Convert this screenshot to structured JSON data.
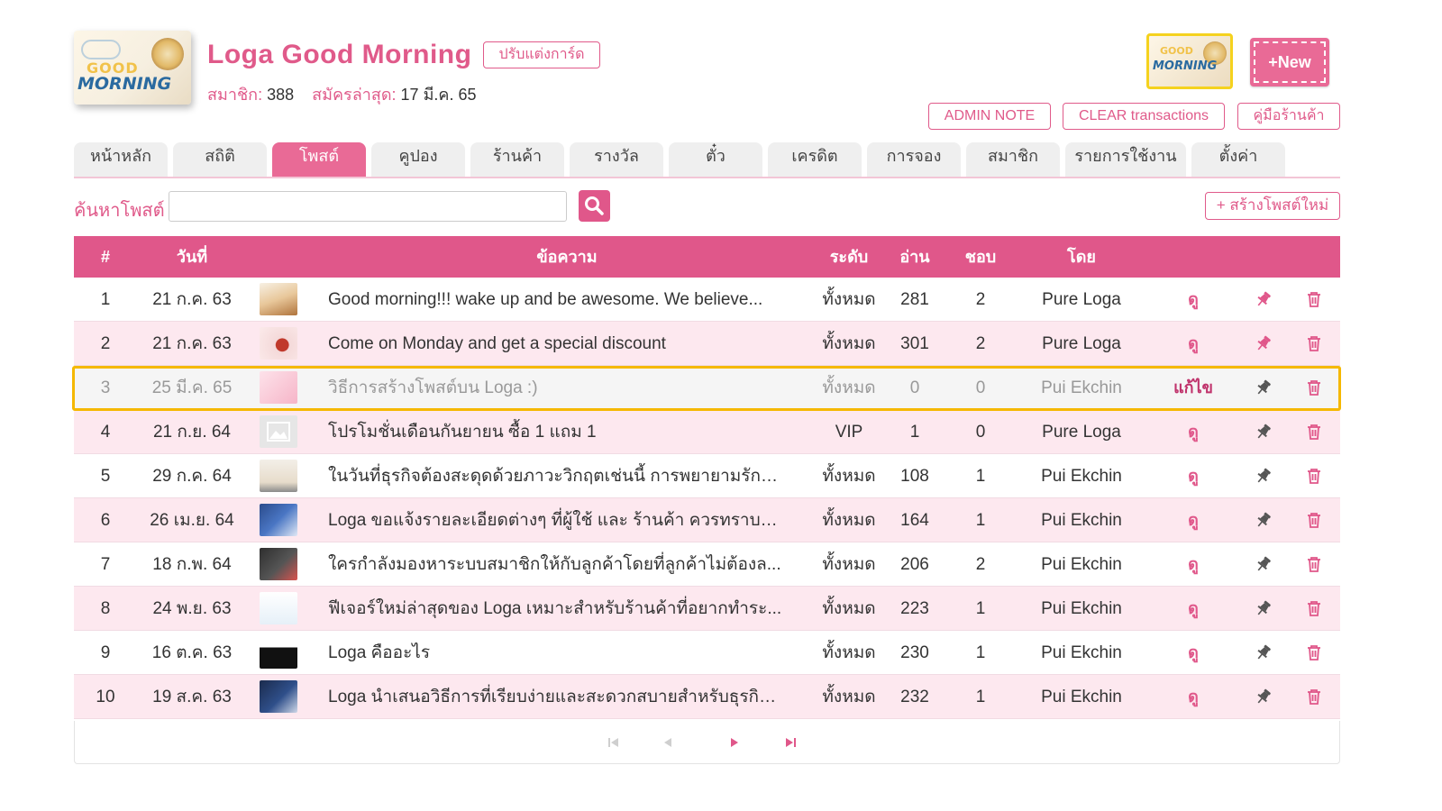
{
  "shop": {
    "name": "Loga Good Morning",
    "customize_label": "ปรับแต่งการ์ด",
    "members_label": "สมาชิก:",
    "members_count": "388",
    "latest_label": "สมัครล่าสุด:",
    "latest_date": "17 มี.ค. 65",
    "logo_text_line1": "GOOD",
    "logo_text_line2": "MORNING",
    "new_label": "+New"
  },
  "toolbar": {
    "admin_note": "ADMIN NOTE",
    "clear_transactions": "CLEAR transactions",
    "manual": "คู่มือร้านค้า"
  },
  "tabs": [
    {
      "label": "หน้าหลัก",
      "active": false
    },
    {
      "label": "สถิติ",
      "active": false
    },
    {
      "label": "โพสต์",
      "active": true
    },
    {
      "label": "คูปอง",
      "active": false
    },
    {
      "label": "ร้านค้า",
      "active": false
    },
    {
      "label": "รางวัล",
      "active": false
    },
    {
      "label": "ตั๋ว",
      "active": false
    },
    {
      "label": "เครดิต",
      "active": false
    },
    {
      "label": "การจอง",
      "active": false
    },
    {
      "label": "สมาชิก",
      "active": false
    },
    {
      "label": "รายการใช้งาน",
      "active": false
    },
    {
      "label": "ตั้งค่า",
      "active": false
    }
  ],
  "search": {
    "label": "ค้นหาโพสต์",
    "value": "",
    "create_label": "+ สร้างโพสต์ใหม่"
  },
  "table": {
    "headers": {
      "num": "#",
      "date": "วันที่",
      "message": "ข้อความ",
      "level": "ระดับ",
      "read": "อ่าน",
      "like": "ชอบ",
      "by": "โดย"
    },
    "rows": [
      {
        "num": "1",
        "date": "21 ก.ค. 63",
        "message": "Good morning!!! wake up and be awesome. We believe...",
        "level": "ทั้งหมด",
        "read": "281",
        "like": "2",
        "by": "Pure Loga",
        "action": "ดู",
        "thumb": "food"
      },
      {
        "num": "2",
        "date": "21 ก.ค. 63",
        "message": "Come on Monday and get a special discount",
        "level": "ทั้งหมด",
        "read": "301",
        "like": "2",
        "by": "Pure Loga",
        "action": "ดู",
        "thumb": "promo"
      },
      {
        "num": "3",
        "date": "25 มี.ค. 65",
        "message": "วิธีการสร้างโพสต์บน Loga :)",
        "level": "ทั้งหมด",
        "read": "0",
        "like": "0",
        "by": "Pui Ekchin",
        "action": "แก้ไข",
        "thumb": "pink",
        "highlight": true
      },
      {
        "num": "4",
        "date": "21 ก.ย. 64",
        "message": "โปรโมชั่นเดือนกันยายน ซื้อ 1 แถม 1",
        "level": "VIP",
        "read": "1",
        "like": "0",
        "by": "Pure Loga",
        "action": "ดู",
        "thumb": "placeholder"
      },
      {
        "num": "5",
        "date": "29 ก.ค. 64",
        "message": "ในวันที่ธุรกิจต้องสะดุดด้วยภาวะวิกฤตเช่นนี้ การพยายามรักษา...",
        "level": "ทั้งหมด",
        "read": "108",
        "like": "1",
        "by": "Pui Ekchin",
        "action": "ดู",
        "thumb": "light"
      },
      {
        "num": "6",
        "date": "26 เม.ย. 64",
        "message": "Loga ขอแจ้งรายละเอียดต่างๆ ที่ผู้ใช้ และ ร้านค้า ควรทราบแ...",
        "level": "ทั้งหมด",
        "read": "164",
        "like": "1",
        "by": "Pui Ekchin",
        "action": "ดู",
        "thumb": "blue"
      },
      {
        "num": "7",
        "date": "18 ก.พ. 64",
        "message": "ใครกำลังมองหาระบบสมาชิกให้กับลูกค้าโดยที่ลูกค้าไม่ต้องล...",
        "level": "ทั้งหมด",
        "read": "206",
        "like": "2",
        "by": "Pui Ekchin",
        "action": "ดู",
        "thumb": "dark"
      },
      {
        "num": "8",
        "date": "24 พ.ย. 63",
        "message": "ฟีเจอร์ใหม่ล่าสุดของ Loga เหมาะสำหรับร้านค้าที่อยากทำระ...",
        "level": "ทั้งหมด",
        "read": "223",
        "like": "1",
        "by": "Pui Ekchin",
        "action": "ดู",
        "thumb": "white"
      },
      {
        "num": "9",
        "date": "16 ต.ค. 63",
        "message": "Loga คืออะไร",
        "level": "ทั้งหมด",
        "read": "230",
        "like": "1",
        "by": "Pui Ekchin",
        "action": "ดู",
        "thumb": "bw"
      },
      {
        "num": "10",
        "date": "19 ส.ค. 63",
        "message": "Loga นำเสนอวิธีการที่เรียบง่ายและสะดวกสบายสำหรับธุรกิจ...",
        "level": "ทั้งหมด",
        "read": "232",
        "like": "1",
        "by": "Pui Ekchin",
        "action": "ดู",
        "thumb": "navy"
      }
    ]
  },
  "colors": {
    "accent": "#e0578a",
    "highlight_border": "#f5b800"
  },
  "icons": {
    "pin": "pin-icon",
    "trash": "trash-icon",
    "search": "search-icon",
    "pager": [
      "first-page-icon",
      "prev-page-icon",
      "next-page-icon",
      "last-page-icon"
    ]
  }
}
